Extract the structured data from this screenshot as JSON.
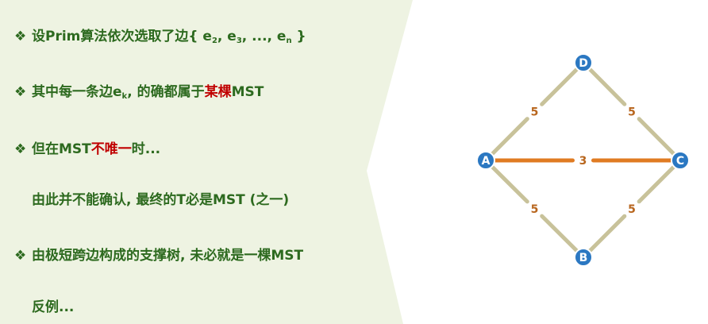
{
  "bullet_glyph": "❖",
  "bullets": [
    {
      "parts": [
        "设Prim算法依次选取了边{ e",
        "2",
        ", e",
        "3",
        ", ..., e",
        "n",
        " }"
      ]
    },
    {
      "parts": [
        "其中每一条边e",
        "k",
        ", 的确都属于",
        "某棵",
        "MST"
      ]
    },
    {
      "parts": [
        "但在MST",
        "不唯一",
        "时..."
      ]
    },
    {
      "parts": [
        "由此并不能确认, 最终的T必是MST (之一)"
      ]
    },
    {
      "parts": [
        "由极短跨边构成的支撑树, 未必就是一棵MST"
      ]
    },
    {
      "parts": [
        "反例..."
      ]
    }
  ],
  "graph": {
    "nodes": [
      {
        "id": "D",
        "label": "D"
      },
      {
        "id": "A",
        "label": "A"
      },
      {
        "id": "C",
        "label": "C"
      },
      {
        "id": "B",
        "label": "B"
      }
    ],
    "edges": [
      {
        "from": "A",
        "to": "D",
        "weight": "5",
        "highlight": false
      },
      {
        "from": "D",
        "to": "C",
        "weight": "5",
        "highlight": false
      },
      {
        "from": "A",
        "to": "C",
        "weight": "3",
        "highlight": true
      },
      {
        "from": "A",
        "to": "B",
        "weight": "5",
        "highlight": false
      },
      {
        "from": "B",
        "to": "C",
        "weight": "5",
        "highlight": false
      }
    ]
  },
  "colors": {
    "text": "#2d6a1f",
    "emphasis": "#c00000",
    "node": "#2b78c2",
    "edge": "#c8c29a",
    "edge_highlight": "#e07b22",
    "weight": "#b8661e"
  }
}
